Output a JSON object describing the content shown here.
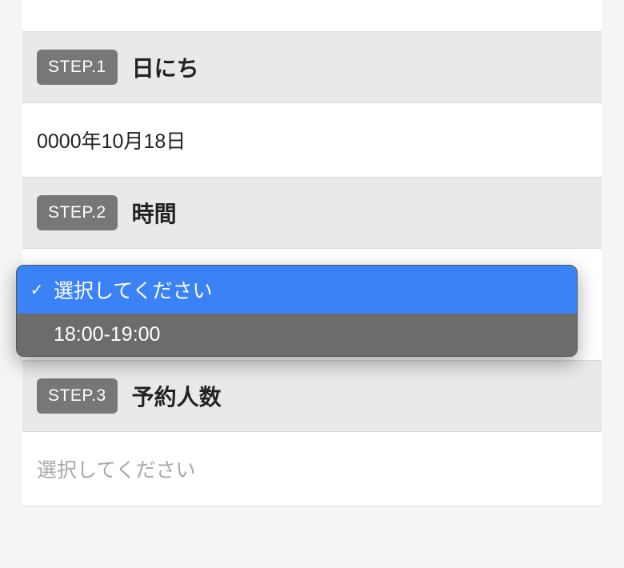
{
  "steps": {
    "step1": {
      "badge": "STEP.1",
      "title": "日にち",
      "value": "0000年10月18日"
    },
    "step2": {
      "badge": "STEP.2",
      "title": "時間",
      "dropdown": {
        "selected_label": "選択してください",
        "options": [
          {
            "label": "選択してください",
            "selected": true
          },
          {
            "label": "18:00-19:00",
            "selected": false
          }
        ]
      }
    },
    "step3": {
      "badge": "STEP.3",
      "title": "予約人数",
      "placeholder": "選択してください"
    }
  },
  "icons": {
    "check": "✓"
  }
}
